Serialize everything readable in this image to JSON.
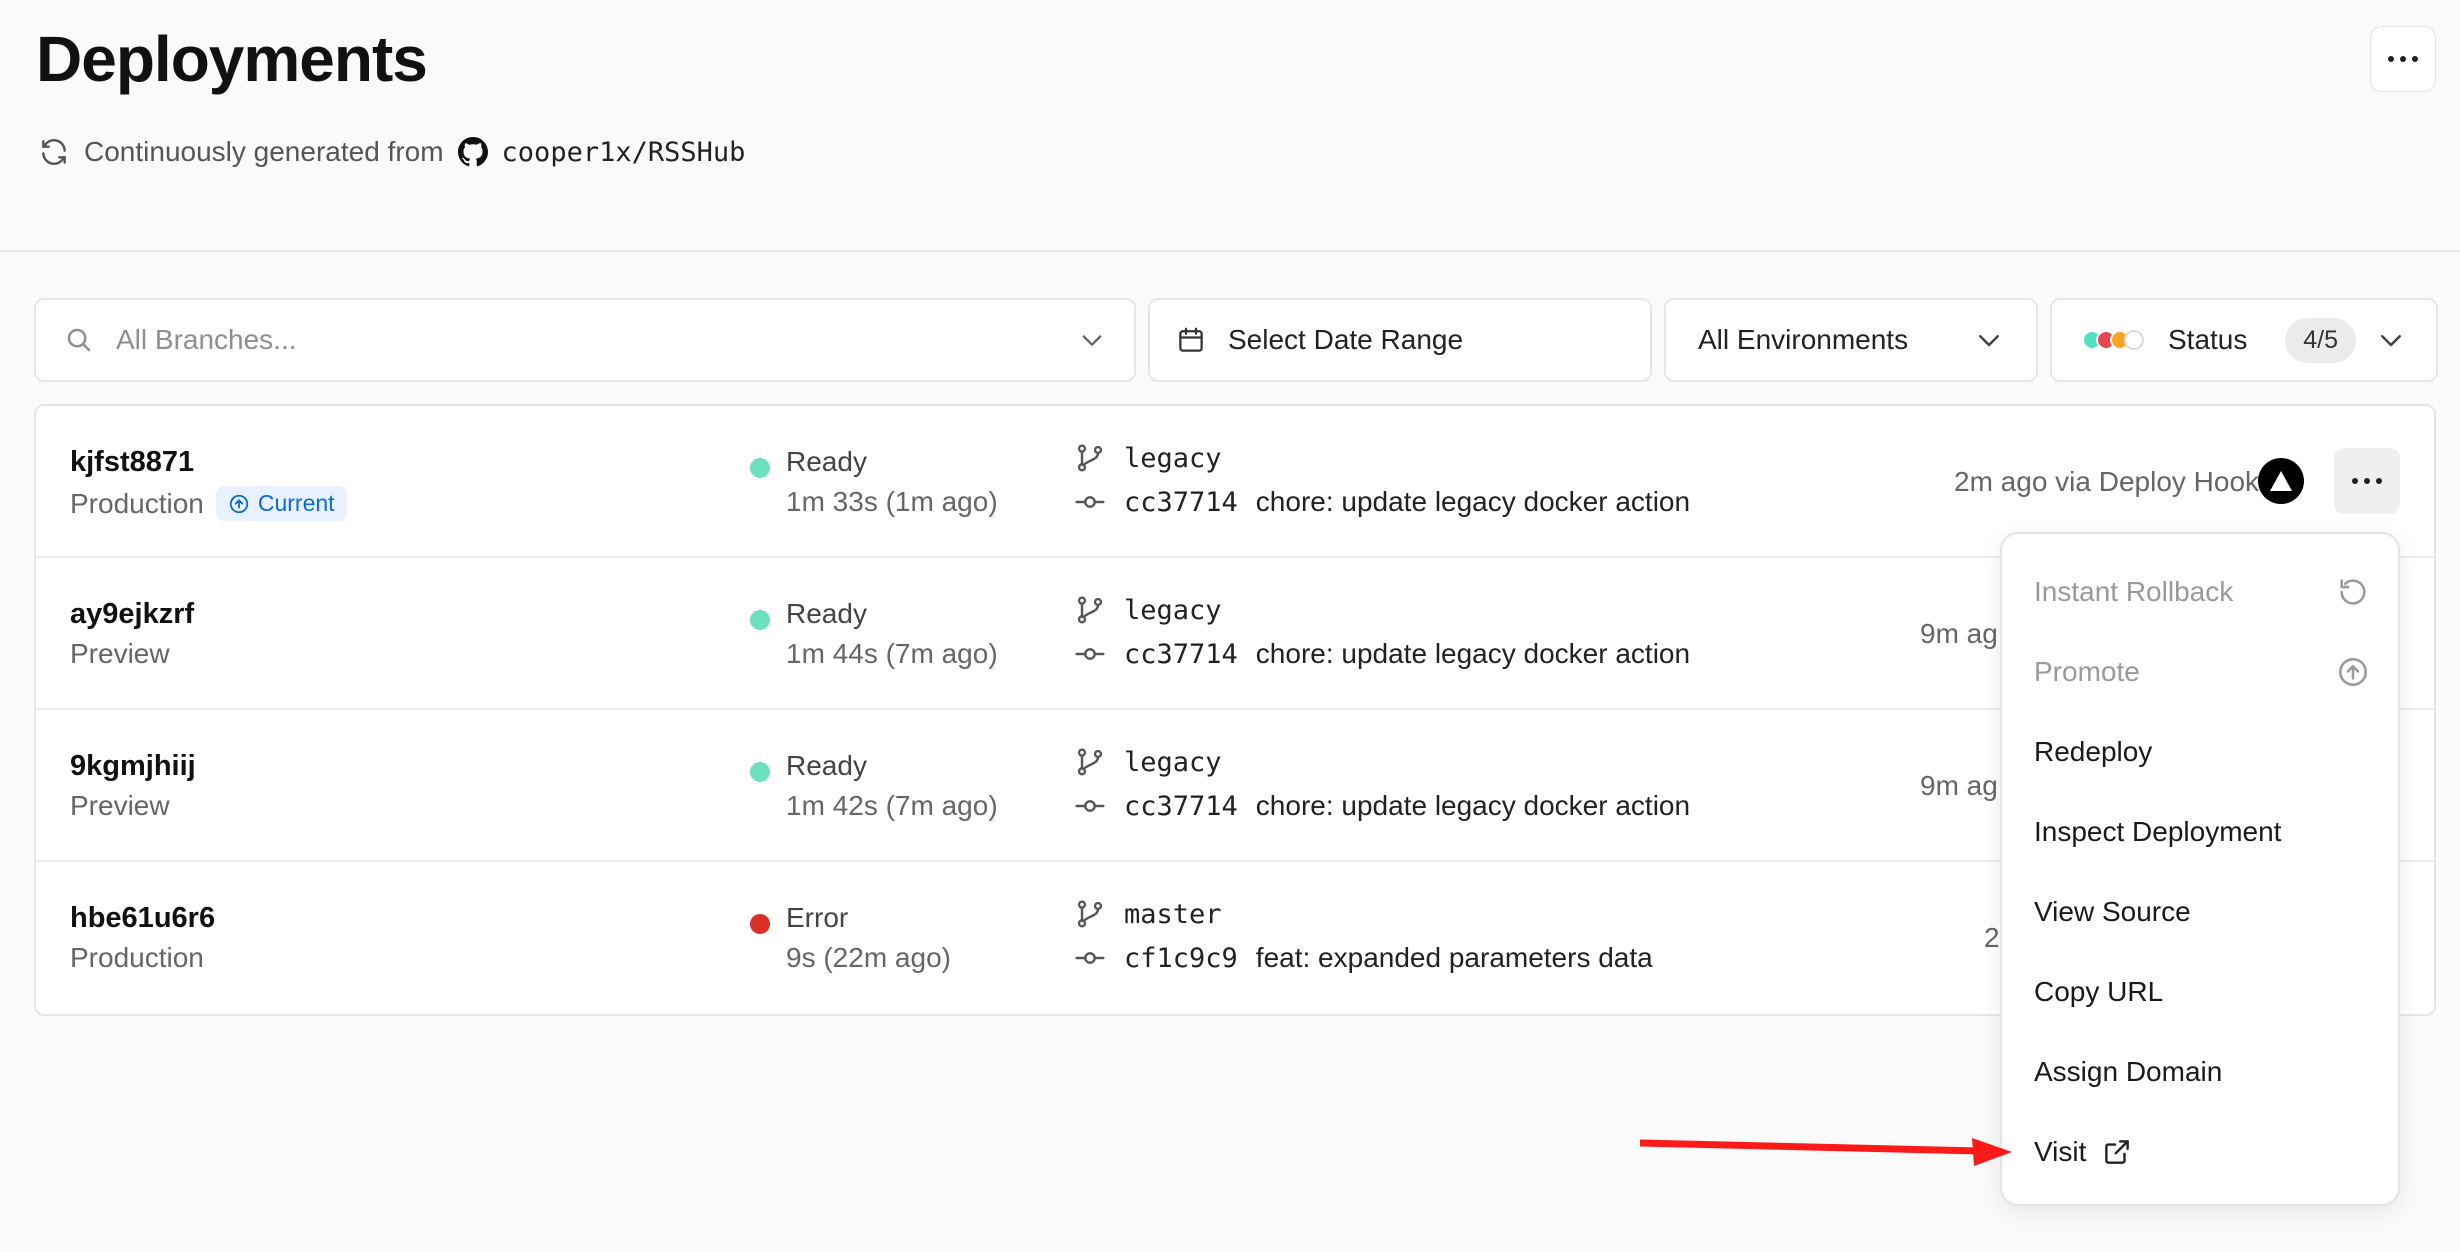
{
  "header": {
    "title": "Deployments",
    "subtitle": "Continuously generated from",
    "repo": "cooper1x/RSSHub"
  },
  "filters": {
    "branches_placeholder": "All Branches...",
    "date_label": "Select Date Range",
    "environment_label": "All Environments",
    "status_label": "Status",
    "status_count": "4/5",
    "status_colors": [
      "#50e3c2",
      "#e5484d",
      "#f5a623",
      "#ffffff"
    ]
  },
  "deployments": [
    {
      "id": "kjfst8871",
      "environment": "Production",
      "current_badge": "Current",
      "status": "Ready",
      "status_color": "#6ee0c0",
      "duration": "1m 33s (1m ago)",
      "branch": "legacy",
      "commit_sha": "cc37714",
      "commit_message": "chore: update legacy docker action",
      "when": "2m ago via Deploy Hook"
    },
    {
      "id": "ay9ejkzrf",
      "environment": "Preview",
      "status": "Ready",
      "status_color": "#6ee0c0",
      "duration": "1m 44s (7m ago)",
      "branch": "legacy",
      "commit_sha": "cc37714",
      "commit_message": "chore: update legacy docker action",
      "when": "9m ag"
    },
    {
      "id": "9kgmjhiij",
      "environment": "Preview",
      "status": "Ready",
      "status_color": "#6ee0c0",
      "duration": "1m 42s (7m ago)",
      "branch": "legacy",
      "commit_sha": "cc37714",
      "commit_message": "chore: update legacy docker action",
      "when": "9m ag"
    },
    {
      "id": "hbe61u6r6",
      "environment": "Production",
      "status": "Error",
      "status_color": "#d93025",
      "duration": "9s (22m ago)",
      "branch": "master",
      "commit_sha": "cf1c9c9",
      "commit_message": "feat: expanded parameters data",
      "when": "2"
    }
  ],
  "menu": {
    "items": [
      {
        "label": "Instant Rollback",
        "disabled": true,
        "icon": "rollback-icon"
      },
      {
        "label": "Promote",
        "disabled": true,
        "icon": "promote-icon"
      },
      {
        "label": "Redeploy",
        "disabled": false
      },
      {
        "label": "Inspect Deployment",
        "disabled": false
      },
      {
        "label": "View Source",
        "disabled": false
      },
      {
        "label": "Copy URL",
        "disabled": false
      },
      {
        "label": "Assign Domain",
        "disabled": false
      },
      {
        "label": "Visit",
        "disabled": false,
        "icon": "external-link-icon"
      }
    ]
  },
  "annotation": {
    "arrow_color": "#ff1a1a"
  }
}
